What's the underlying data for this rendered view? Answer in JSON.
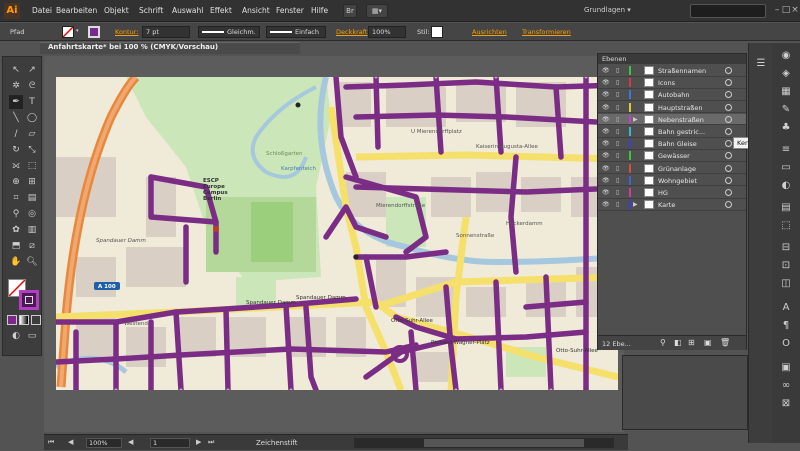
{
  "app": {
    "logo": "Ai",
    "workspace": "Grundlagen",
    "bridge_label": "Br"
  },
  "menu": [
    "Datei",
    "Bearbeiten",
    "Objekt",
    "Schrift",
    "Auswahl",
    "Effekt",
    "Ansicht",
    "Fenster",
    "Hilfe"
  ],
  "control_bar": {
    "selection_label": "Pfad",
    "kontur_label": "Kontur:",
    "stroke_width": "7 pt",
    "profile_label": "Gleichm.",
    "brush_label": "Einfach",
    "deckkraft_label": "Deckkraft",
    "opacity_value": "100%",
    "stil_label": "Stil:",
    "ausrichten_label": "Ausrichten",
    "transformieren_label": "Transformieren"
  },
  "document": {
    "tab_title": "Anfahrtskarte* bei 100 % (CMYK/Vorschau)"
  },
  "status_bar": {
    "zoom": "100%",
    "page": "1",
    "tool_name": "Zeichenstift"
  },
  "layers_panel": {
    "title": "Ebenen",
    "count_label": "12 Ebe...",
    "layers": [
      {
        "name": "Straßennamen",
        "color": "#3cc43c"
      },
      {
        "name": "Icons",
        "color": "#d23c3c"
      },
      {
        "name": "Autobahn",
        "color": "#3c78dc"
      },
      {
        "name": "Hauptstraßen",
        "color": "#e0c83c"
      },
      {
        "name": "Nebenstraßen",
        "color": "#c83cc8",
        "selected": true
      },
      {
        "name": "Bahn gestric...",
        "color": "#3cb4d8"
      },
      {
        "name": "Bahn Gleise",
        "color": "#3c3cd8"
      },
      {
        "name": "Gewässer",
        "color": "#3cc43c"
      },
      {
        "name": "Grünanlage",
        "color": "#d2503c"
      },
      {
        "name": "Wohngebiet",
        "color": "#3c64d2"
      },
      {
        "name": "HG",
        "color": "#d23ca0"
      },
      {
        "name": "Karte",
        "color": "#3c3cd8",
        "expandable": true
      }
    ]
  },
  "tooltip": "Kennzeichnet aus",
  "map": {
    "labels": [
      {
        "text": "ESCP",
        "k": "escp1"
      },
      {
        "text": "Europe",
        "k": "escp2"
      },
      {
        "text": "Campus",
        "k": "escp3"
      },
      {
        "text": "Berlin",
        "k": "escp4"
      },
      {
        "text": "U Mierendorffplatz",
        "k": "mierendorff"
      },
      {
        "text": "Kaiserin-Augusta-Allee",
        "k": "kaiserin"
      },
      {
        "text": "Spandauer Damm",
        "k": "spandauer1"
      },
      {
        "text": "Spandauer Damm",
        "k": "spandauer2"
      },
      {
        "text": "Spandauer Damm",
        "k": "spandauer3"
      },
      {
        "text": "Richard-Wagner-Platz",
        "k": "wagner"
      },
      {
        "text": "Otto-Suhr-Allee",
        "k": "ottosuhr1"
      },
      {
        "text": "Otto-Suhr-Allee",
        "k": "ottosuhr2"
      },
      {
        "text": "A 100",
        "k": "a100"
      },
      {
        "text": "Schloßgarten",
        "k": "schloss"
      },
      {
        "text": "Karpfenteich",
        "k": "karpfen"
      },
      {
        "text": "Mierendorffstraße",
        "k": "mierstr"
      },
      {
        "text": "Heckerdamm",
        "k": "hecker"
      },
      {
        "text": "Sonnenstraße",
        "k": "sonnen"
      },
      {
        "text": "Westend",
        "k": "westend"
      }
    ]
  }
}
